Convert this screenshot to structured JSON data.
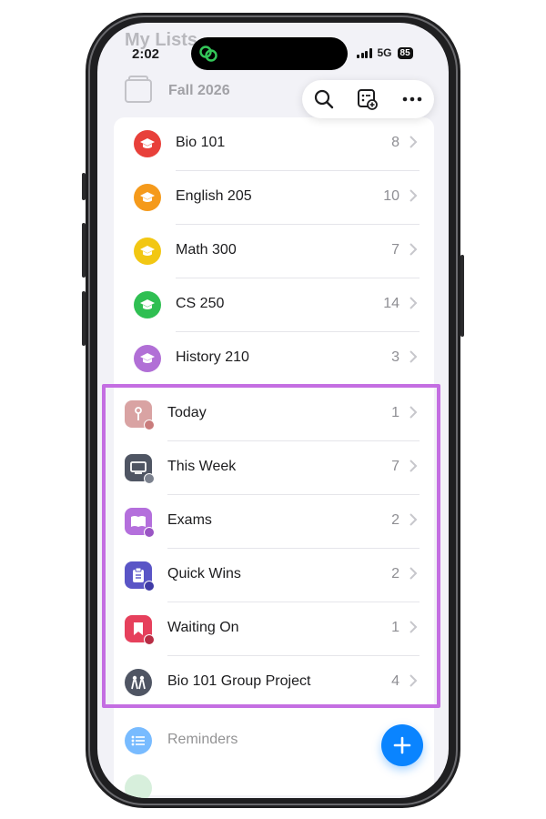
{
  "status": {
    "time": "2:02",
    "network": "5G",
    "battery": "85"
  },
  "header": {
    "ghost_title": "My Lists",
    "folder_name": "Fall 2026"
  },
  "courses": [
    {
      "label": "Bio 101",
      "count": "8",
      "color": "#e8403a"
    },
    {
      "label": "English 205",
      "count": "10",
      "color": "#f59a1b"
    },
    {
      "label": "Math 300",
      "count": "7",
      "color": "#f2c713"
    },
    {
      "label": "CS 250",
      "count": "14",
      "color": "#2fbf52"
    },
    {
      "label": "History 210",
      "count": "3",
      "color": "#b16fd6"
    }
  ],
  "smart_lists": [
    {
      "label": "Today",
      "count": "1",
      "color": "#d9a3a3",
      "icon": "pin-icon"
    },
    {
      "label": "This Week",
      "count": "7",
      "color": "#4f5563",
      "icon": "monitor-icon"
    },
    {
      "label": "Exams",
      "count": "2",
      "color": "#b46fdc",
      "icon": "book-icon"
    },
    {
      "label": "Quick Wins",
      "count": "2",
      "color": "#5a55c6",
      "icon": "clipboard-icon"
    },
    {
      "label": "Waiting On",
      "count": "1",
      "color": "#e6405c",
      "icon": "bookmark-icon"
    },
    {
      "label": "Bio 101 Group Project",
      "count": "4",
      "color": "#4f5563",
      "icon": "people-icon"
    }
  ],
  "reminders": {
    "label": "Reminders",
    "color": "#0a84ff"
  },
  "colors": {
    "highlight": "#c46ee2",
    "accent": "#0a84ff"
  }
}
